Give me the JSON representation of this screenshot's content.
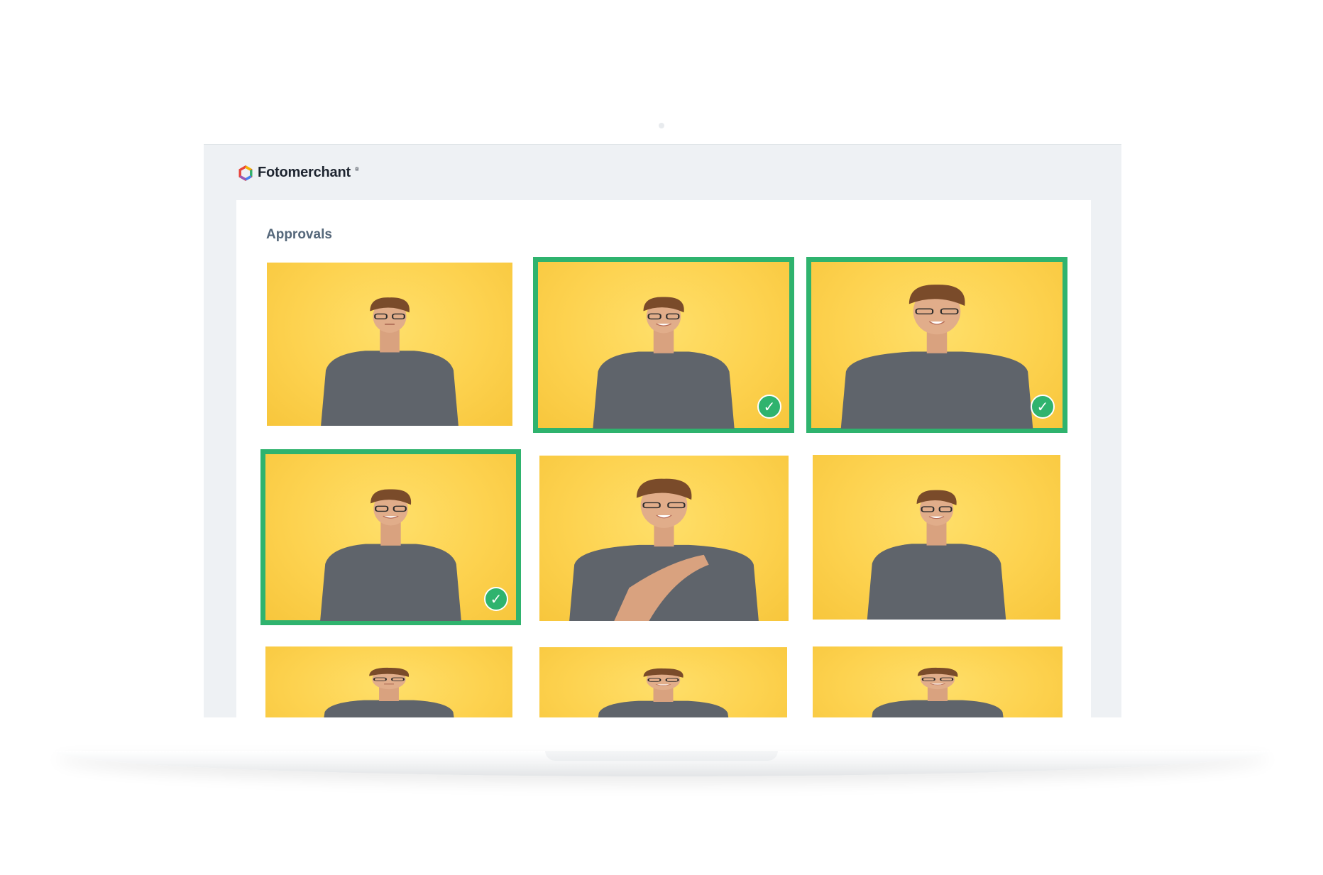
{
  "app": {
    "brand_name": "Fotomerchant",
    "brand_trademark": "®",
    "brand_colors": [
      "#e8453c",
      "#f4b400",
      "#2fb36e",
      "#4285f4",
      "#9b59b6"
    ]
  },
  "approvals": {
    "title": "Approvals",
    "selected_color": "#2fb36e",
    "check_icon": "check-icon",
    "photos": [
      {
        "selected": false,
        "pose": "neutral"
      },
      {
        "selected": true,
        "pose": "smile"
      },
      {
        "selected": true,
        "pose": "closeup-smile"
      },
      {
        "selected": true,
        "pose": "smile"
      },
      {
        "selected": false,
        "pose": "hand-on-shoulder"
      },
      {
        "selected": false,
        "pose": "smile"
      },
      {
        "selected": false,
        "pose": "neutral"
      },
      {
        "selected": false,
        "pose": "smile"
      },
      {
        "selected": false,
        "pose": "smile"
      }
    ]
  }
}
